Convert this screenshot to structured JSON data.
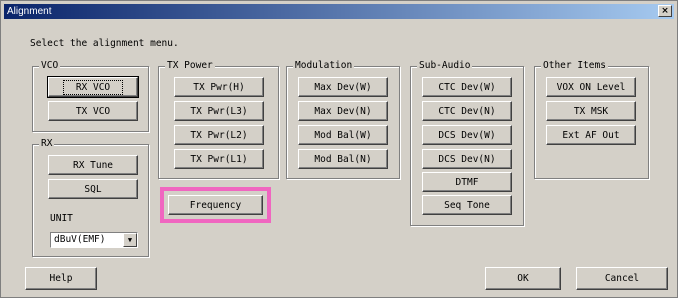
{
  "window": {
    "title": "Alignment",
    "close_label": "×"
  },
  "prompt": "Select the alignment menu.",
  "vco": {
    "legend": "VCO",
    "buttons": [
      "RX VCO",
      "TX VCO"
    ]
  },
  "rx": {
    "legend": "RX",
    "buttons": [
      "RX Tune",
      "SQL"
    ],
    "unit_label": "UNIT",
    "unit_value": "dBuV(EMF)"
  },
  "tx_power": {
    "legend": "TX Power",
    "buttons": [
      "TX Pwr(H)",
      "TX Pwr(L3)",
      "TX Pwr(L2)",
      "TX Pwr(L1)"
    ]
  },
  "frequency": {
    "label": "Frequency"
  },
  "modulation": {
    "legend": "Modulation",
    "buttons": [
      "Max Dev(W)",
      "Max Dev(N)",
      "Mod Bal(W)",
      "Mod Bal(N)"
    ]
  },
  "sub_audio": {
    "legend": "Sub-Audio",
    "buttons": [
      "CTC Dev(W)",
      "CTC Dev(N)",
      "DCS Dev(W)",
      "DCS Dev(N)",
      "DTMF",
      "Seq Tone"
    ]
  },
  "other_items": {
    "legend": "Other Items",
    "buttons": [
      "VOX ON Level",
      "TX MSK",
      "Ext AF Out"
    ]
  },
  "footer": {
    "help": "Help",
    "ok": "OK",
    "cancel": "Cancel"
  },
  "colors": {
    "highlight": "#f066c0",
    "title_start": "#0a246a",
    "title_end": "#a6caf0"
  }
}
